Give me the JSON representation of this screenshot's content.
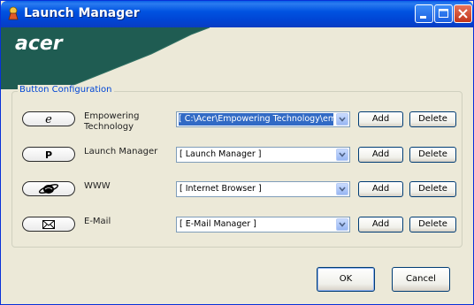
{
  "window": {
    "title": "Launch Manager"
  },
  "logo": {
    "text": "acer"
  },
  "group": {
    "title": "Button Configuration"
  },
  "rows": [
    {
      "button_glyph": "e",
      "label_line1": "Empowering",
      "label_line2": "Technology",
      "value": "[ C:\\Acer\\Empowering Technology\\emp",
      "add": "Add",
      "delete": "Delete"
    },
    {
      "button_glyph": "P",
      "label_line1": "Launch Manager",
      "label_line2": "",
      "value": "[ Launch Manager ]",
      "add": "Add",
      "delete": "Delete"
    },
    {
      "button_glyph": "globe",
      "label_line1": "WWW",
      "label_line2": "",
      "value": "[ Internet Browser ]",
      "add": "Add",
      "delete": "Delete"
    },
    {
      "button_glyph": "envelope",
      "label_line1": "E-Mail",
      "label_line2": "",
      "value": "[ E-Mail Manager ]",
      "add": "Add",
      "delete": "Delete"
    }
  ],
  "footer": {
    "ok": "OK",
    "cancel": "Cancel"
  },
  "colors": {
    "title_bar": "#0053e1",
    "band": "#1f5c52",
    "selection": "#316ac5"
  }
}
